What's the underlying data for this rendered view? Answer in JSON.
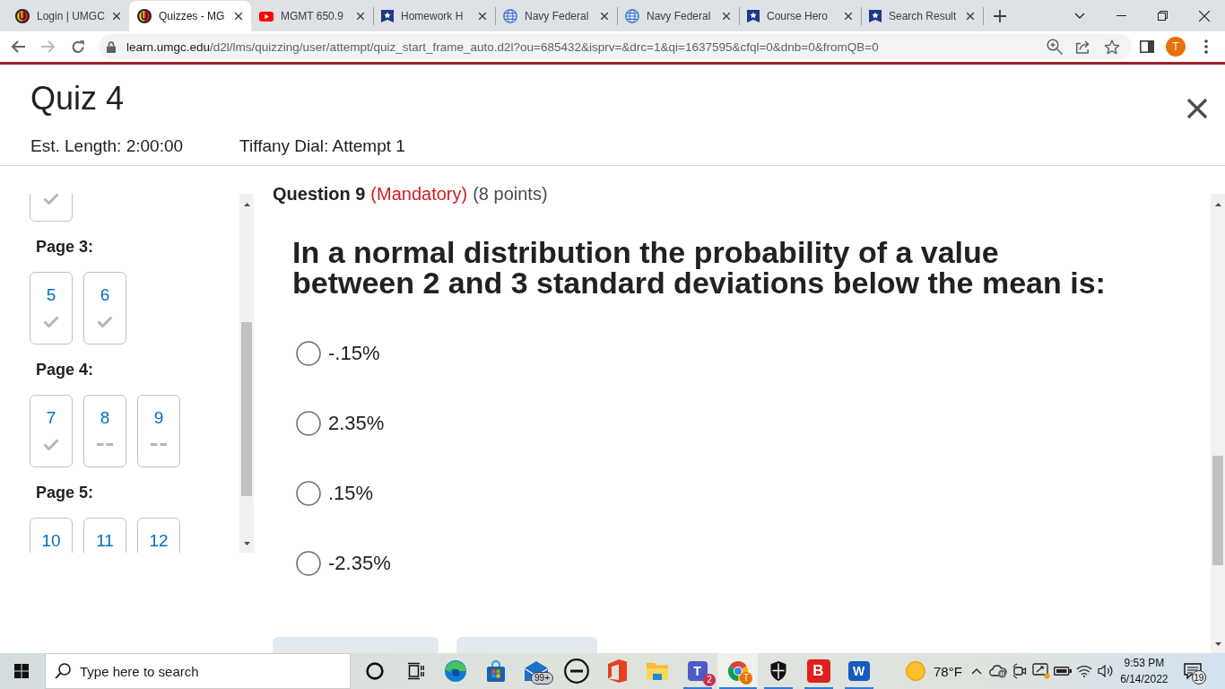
{
  "browser": {
    "tabs": [
      {
        "kind": "umgc",
        "title": "Login | UMGC",
        "selected": false
      },
      {
        "kind": "umgc",
        "title": "Quizzes - MG",
        "selected": true
      },
      {
        "kind": "video",
        "title": "MGMT 650.9",
        "selected": false
      },
      {
        "kind": "star-banner",
        "title": "Homework H",
        "selected": false
      },
      {
        "kind": "globe",
        "title": "Navy Federal",
        "selected": false
      },
      {
        "kind": "globe",
        "title": "Navy Federal",
        "selected": false
      },
      {
        "kind": "star-banner",
        "title": "Course Hero",
        "selected": false
      },
      {
        "kind": "star-banner",
        "title": "Search Result",
        "selected": false
      }
    ],
    "address": {
      "domain": "learn.umgc.edu",
      "path": "/d2l/lms/quizzing/user/attempt/quiz_start_frame_auto.d2l?ou=685432&isprv=&drc=1&qi=1637595&cfql=0&dnb=0&fromQB=0"
    },
    "profile": "T"
  },
  "quiz": {
    "title": "Quiz 4",
    "est_length": "Est. Length: 2:00:00",
    "attempt": "Tiffany Dial: Attempt 1"
  },
  "navigator": {
    "pages": [
      {
        "questions": [
          {
            "answered": true
          }
        ]
      },
      {
        "label": "Page 3:",
        "questions": [
          {
            "number": "5",
            "answered": true
          },
          {
            "number": "6",
            "answered": true
          }
        ]
      },
      {
        "label": "Page 4:",
        "questions": [
          {
            "number": "7",
            "answered": true
          },
          {
            "number": "8",
            "answered": false
          },
          {
            "number": "9",
            "answered": false
          }
        ]
      },
      {
        "label": "Page 5:",
        "questions": [
          {
            "number": "10"
          },
          {
            "number": "11"
          },
          {
            "number": "12"
          }
        ]
      }
    ]
  },
  "question": {
    "heading": "Question 9",
    "mandatory": "(Mandatory)",
    "points": "(8 points)",
    "text": "In a normal distribution the probability of a value between 2 and 3 standard deviations below the mean is:",
    "options": [
      {
        "label": "-.15%",
        "selected": false
      },
      {
        "label": "2.35%",
        "selected": false
      },
      {
        "label": ".15%",
        "selected": false
      },
      {
        "label": "-2.35%",
        "selected": false
      }
    ]
  },
  "taskbar": {
    "search": {
      "placeholder": "Type here to search"
    },
    "apps": [
      {
        "kind": "cortana",
        "running": false,
        "active": false
      },
      {
        "kind": "task-view",
        "running": false,
        "active": false
      },
      {
        "kind": "edge",
        "running": false,
        "active": false
      },
      {
        "kind": "store",
        "running": false,
        "active": false
      },
      {
        "kind": "mail",
        "badge": "99+",
        "running": false,
        "active": false
      },
      {
        "kind": "dell",
        "running": false,
        "active": false
      },
      {
        "kind": "office",
        "running": false,
        "active": false
      },
      {
        "kind": "explorer",
        "running": false,
        "active": false
      },
      {
        "kind": "teams",
        "glyph": "T",
        "badge": "2",
        "running": true,
        "active": false
      },
      {
        "kind": "chrome",
        "badge": "T",
        "running": true,
        "active": true
      },
      {
        "kind": "shield",
        "running": true,
        "active": false
      },
      {
        "kind": "letter-app",
        "glyph": "B",
        "running": true,
        "active": false
      },
      {
        "kind": "word",
        "glyph": "W",
        "running": true,
        "active": false
      }
    ],
    "weather": "78°F",
    "time": "9:53 PM",
    "date": "6/14/2022",
    "notifications": "19"
  }
}
